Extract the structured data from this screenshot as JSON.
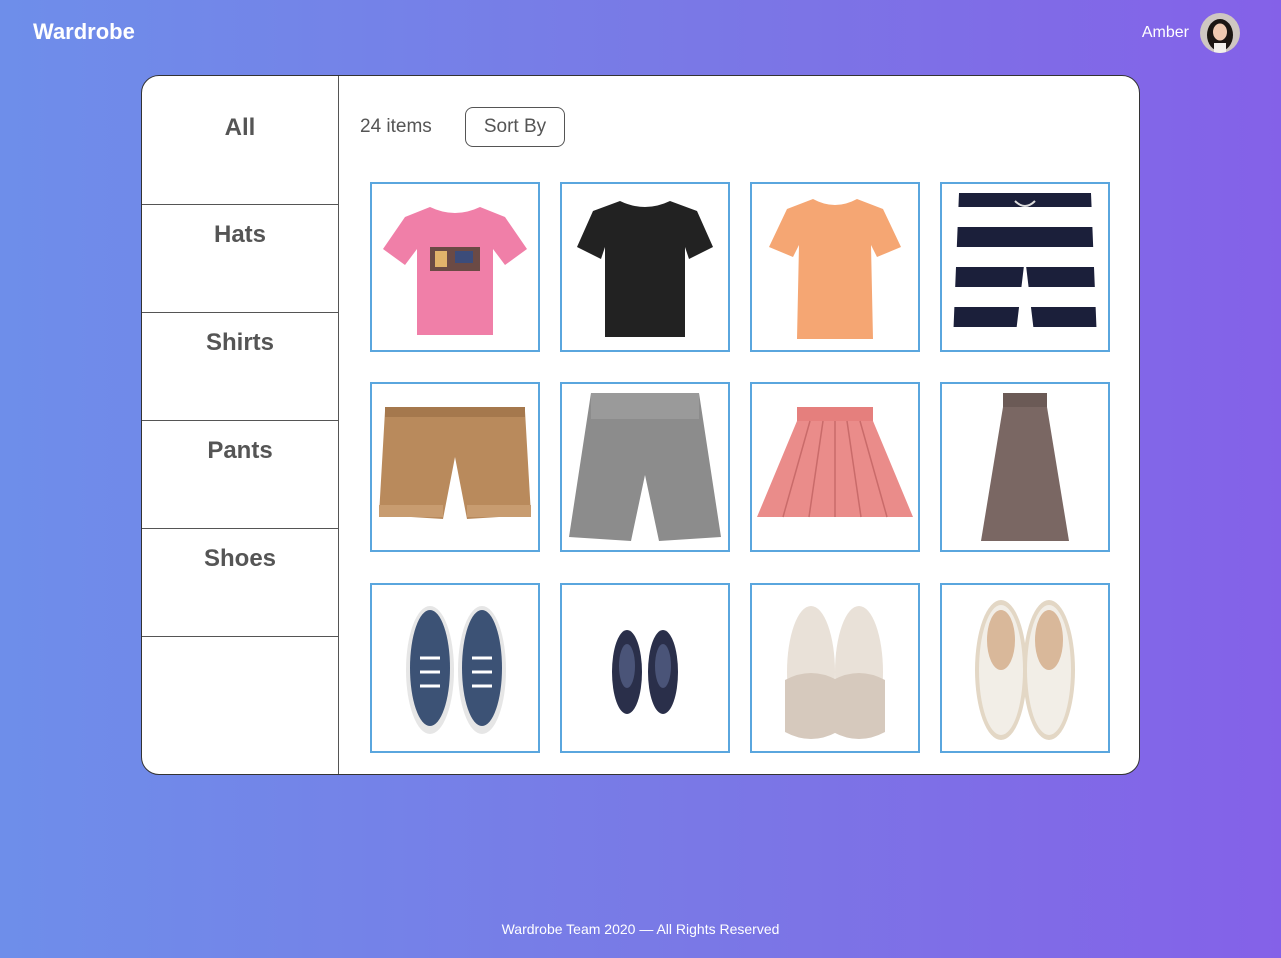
{
  "app": {
    "brand": "Wardrobe"
  },
  "user": {
    "name": "Amber"
  },
  "categories": [
    {
      "label": "All"
    },
    {
      "label": "Hats"
    },
    {
      "label": "Shirts"
    },
    {
      "label": "Pants"
    },
    {
      "label": "Shoes"
    }
  ],
  "toolbar": {
    "item_count": "24 items",
    "sort_label": "Sort By"
  },
  "items": [
    {
      "name": "pink-graphic-tshirt",
      "color": "#f07fa8"
    },
    {
      "name": "black-tshirt",
      "color": "#222222"
    },
    {
      "name": "orange-tshirt",
      "color": "#f5a673"
    },
    {
      "name": "striped-shorts",
      "color": "#1b1f3a"
    },
    {
      "name": "tan-denim-shorts",
      "color": "#b98a5c"
    },
    {
      "name": "gray-shorts",
      "color": "#8c8c8c"
    },
    {
      "name": "pink-pleated-skirt",
      "color": "#ea8c8a"
    },
    {
      "name": "brown-maxi-skirt",
      "color": "#7a6763"
    },
    {
      "name": "navy-sneakers",
      "color": "#3c5275"
    },
    {
      "name": "dark-running-shoes",
      "color": "#2a2f4a"
    },
    {
      "name": "beige-slides",
      "color": "#ddd2c8"
    },
    {
      "name": "white-espadrilles",
      "color": "#f2eee7"
    }
  ],
  "footer": {
    "text": "Wardrobe Team 2020   —   All Rights Reserved"
  }
}
